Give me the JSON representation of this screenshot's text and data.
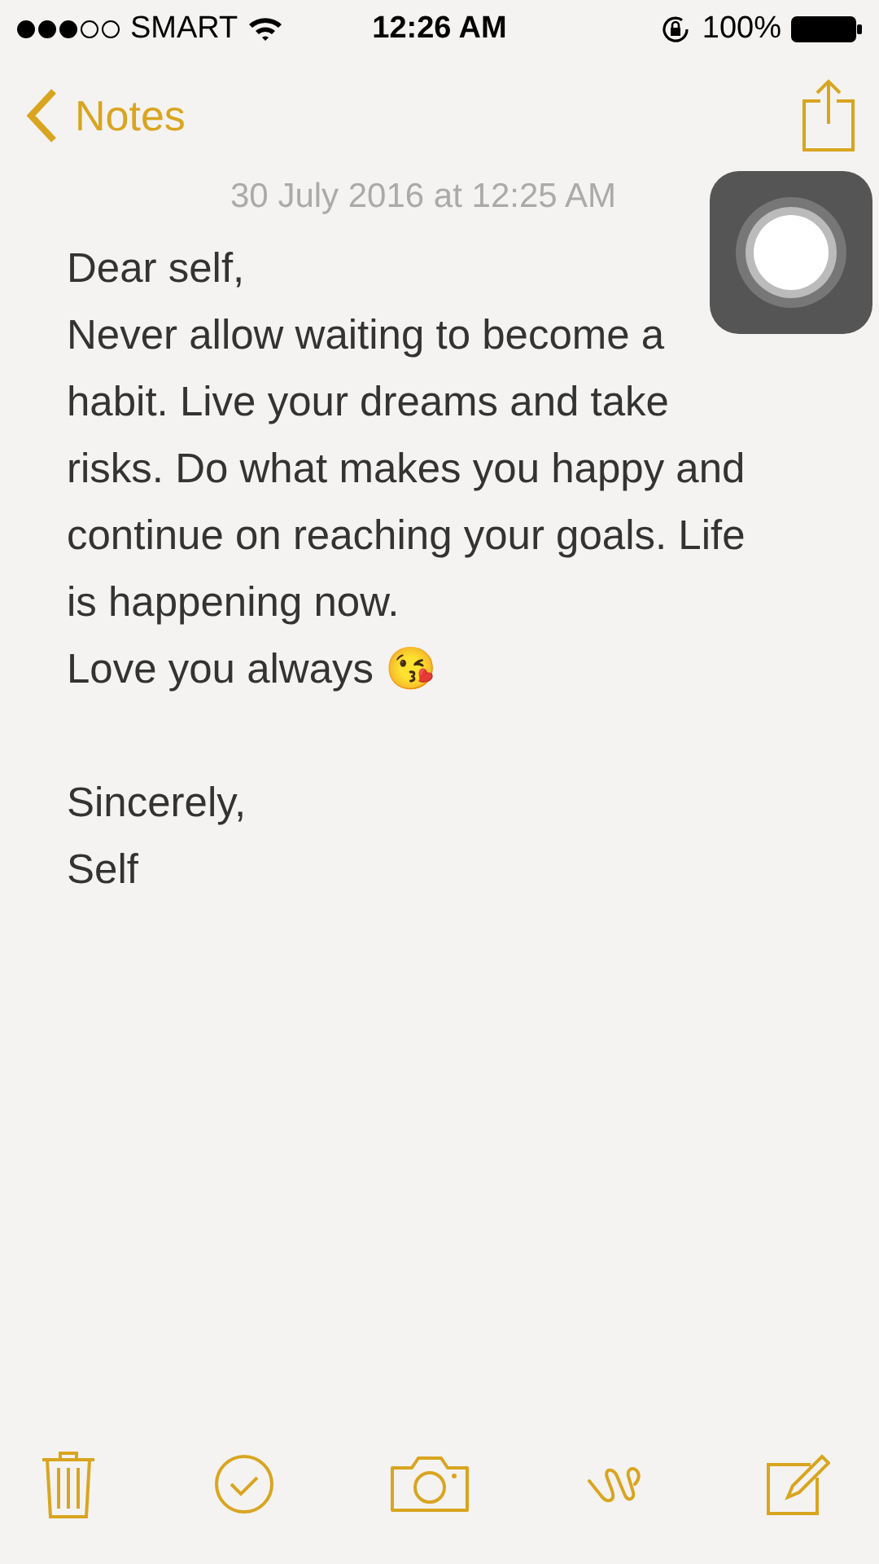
{
  "status_bar": {
    "carrier": "SMART",
    "time": "12:26 AM",
    "battery": "100%"
  },
  "nav": {
    "back": "Notes"
  },
  "note": {
    "date": "30 July 2016 at 12:25 AM",
    "blocks": [
      [
        "Dear self,",
        "Never allow waiting to become a habit. Live your dreams and take risks. Do what makes you happy and continue on reaching your goals. Life is happening now.",
        "Love you always 😘"
      ],
      [
        "Sincerely,",
        "Self"
      ]
    ]
  }
}
